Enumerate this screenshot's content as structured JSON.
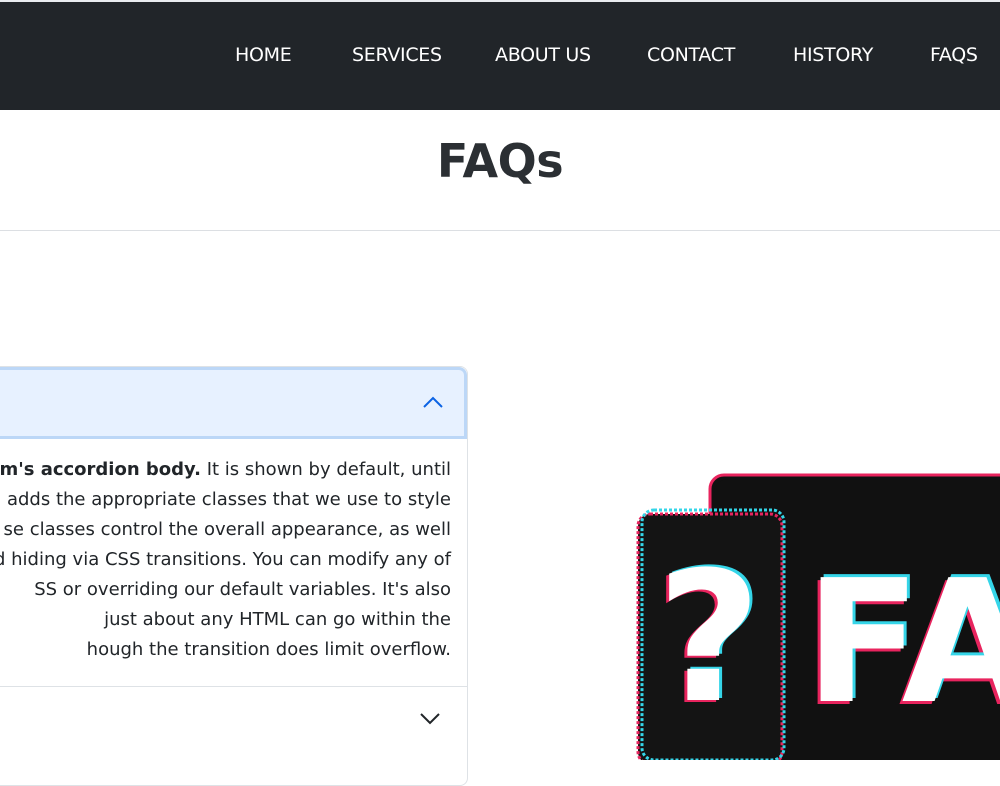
{
  "nav": {
    "items": [
      {
        "label": "HOME"
      },
      {
        "label": "SERVICES"
      },
      {
        "label": "ABOUT US"
      },
      {
        "label": "CONTACT"
      },
      {
        "label": "HISTORY"
      },
      {
        "label": "FAQS"
      }
    ]
  },
  "page": {
    "title": "FAQs"
  },
  "accordion": {
    "body_bold": "em's accordion body.",
    "body_lines": [
      " It is shown by default, until",
      "n adds the appropriate classes that we use to style",
      "se classes control the overall appearance, as well",
      "d hiding via CSS transitions. You can modify any of",
      "SS or overriding our default variables. It's also",
      "just about any HTML can go within the",
      "hough the transition does limit overflow."
    ]
  },
  "logo": {
    "glyph": "?",
    "text": "FAQ"
  },
  "colors": {
    "nav_bg": "#212529",
    "accent_bg": "#e7f1ff",
    "accent_border": "#bcd7f7",
    "chevron_open": "#0c63e4",
    "chevron_closed": "#212529"
  }
}
